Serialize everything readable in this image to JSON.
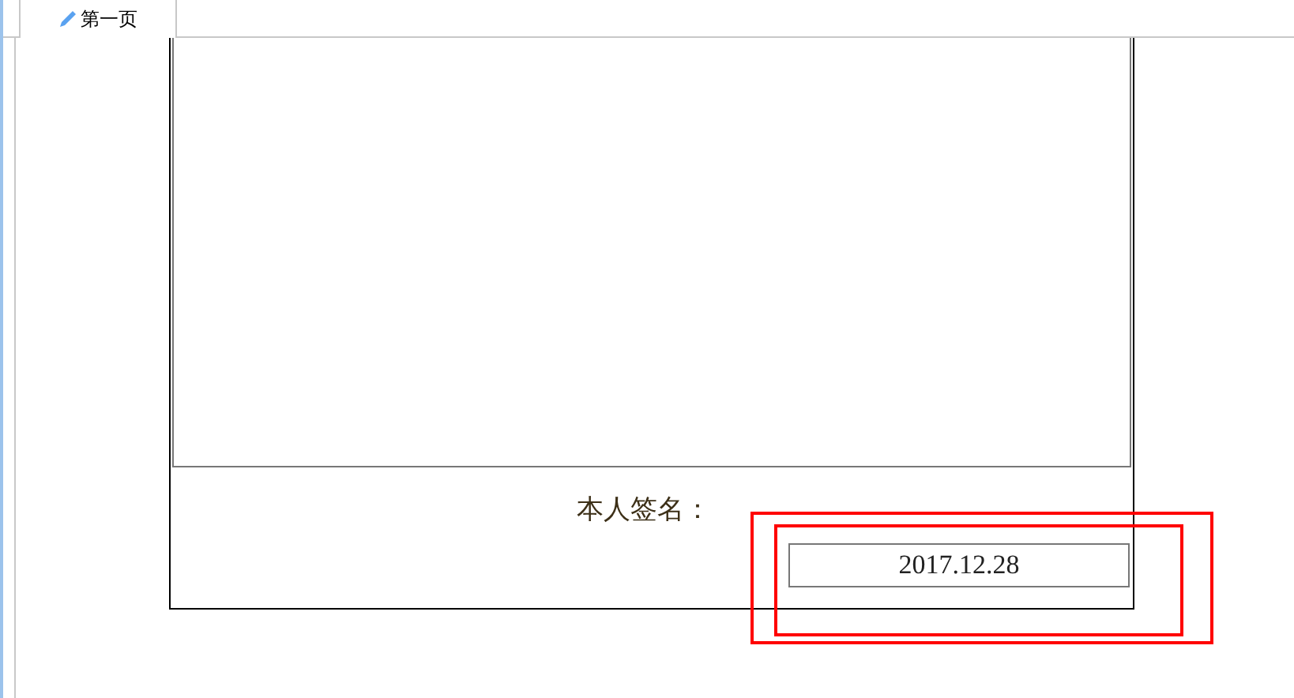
{
  "tabs": [
    {
      "label": "第一页",
      "selected": true
    }
  ],
  "signature": {
    "label": "本人签名：",
    "date": "2017.12.28"
  }
}
